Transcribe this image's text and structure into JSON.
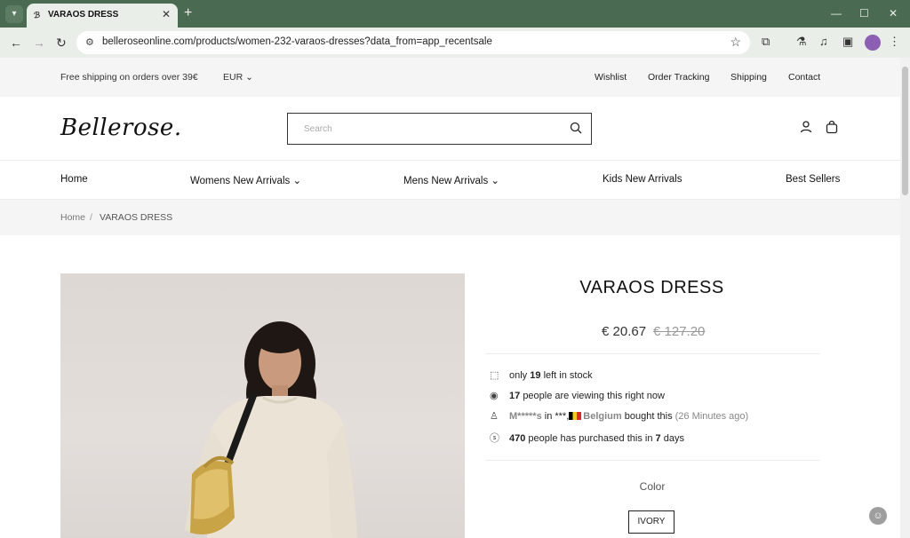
{
  "browser": {
    "tab_title": "VARAOS DRESS",
    "url": "belleroseonline.com/products/women-232-varaos-dresses?data_from=app_recentsale"
  },
  "topbar": {
    "shipping_note": "Free shipping on orders over 39€",
    "currency": "EUR",
    "links": [
      "Wishlist",
      "Order Tracking",
      "Shipping",
      "Contact"
    ]
  },
  "header": {
    "logo": "Bellerose.",
    "search_placeholder": "Search"
  },
  "nav": {
    "items": [
      "Home",
      "Womens New Arrivals",
      "Mens New Arrivals",
      "Kids New Arrivals",
      "Best Sellers"
    ]
  },
  "breadcrumb": {
    "home": "Home",
    "separator": "/",
    "current": "VARAOS DRESS"
  },
  "product": {
    "title": "VARAOS DRESS",
    "price": "€ 20.67",
    "old_price": "€ 127.20",
    "stock_prefix": "only",
    "stock_count": "19",
    "stock_suffix": "left in stock",
    "viewers_count": "17",
    "viewers_suffix": "people are viewing this right now",
    "recent_buyer": "M*****s",
    "recent_in": "in ***,",
    "recent_country": "Belgium",
    "recent_action": "bought this",
    "recent_time": "(26 Minutes ago)",
    "purchased_count": "470",
    "purchased_mid": "people has purchased this in",
    "purchased_days": "7",
    "purchased_suffix": "days",
    "color_label": "Color",
    "color_value": "IVORY"
  }
}
